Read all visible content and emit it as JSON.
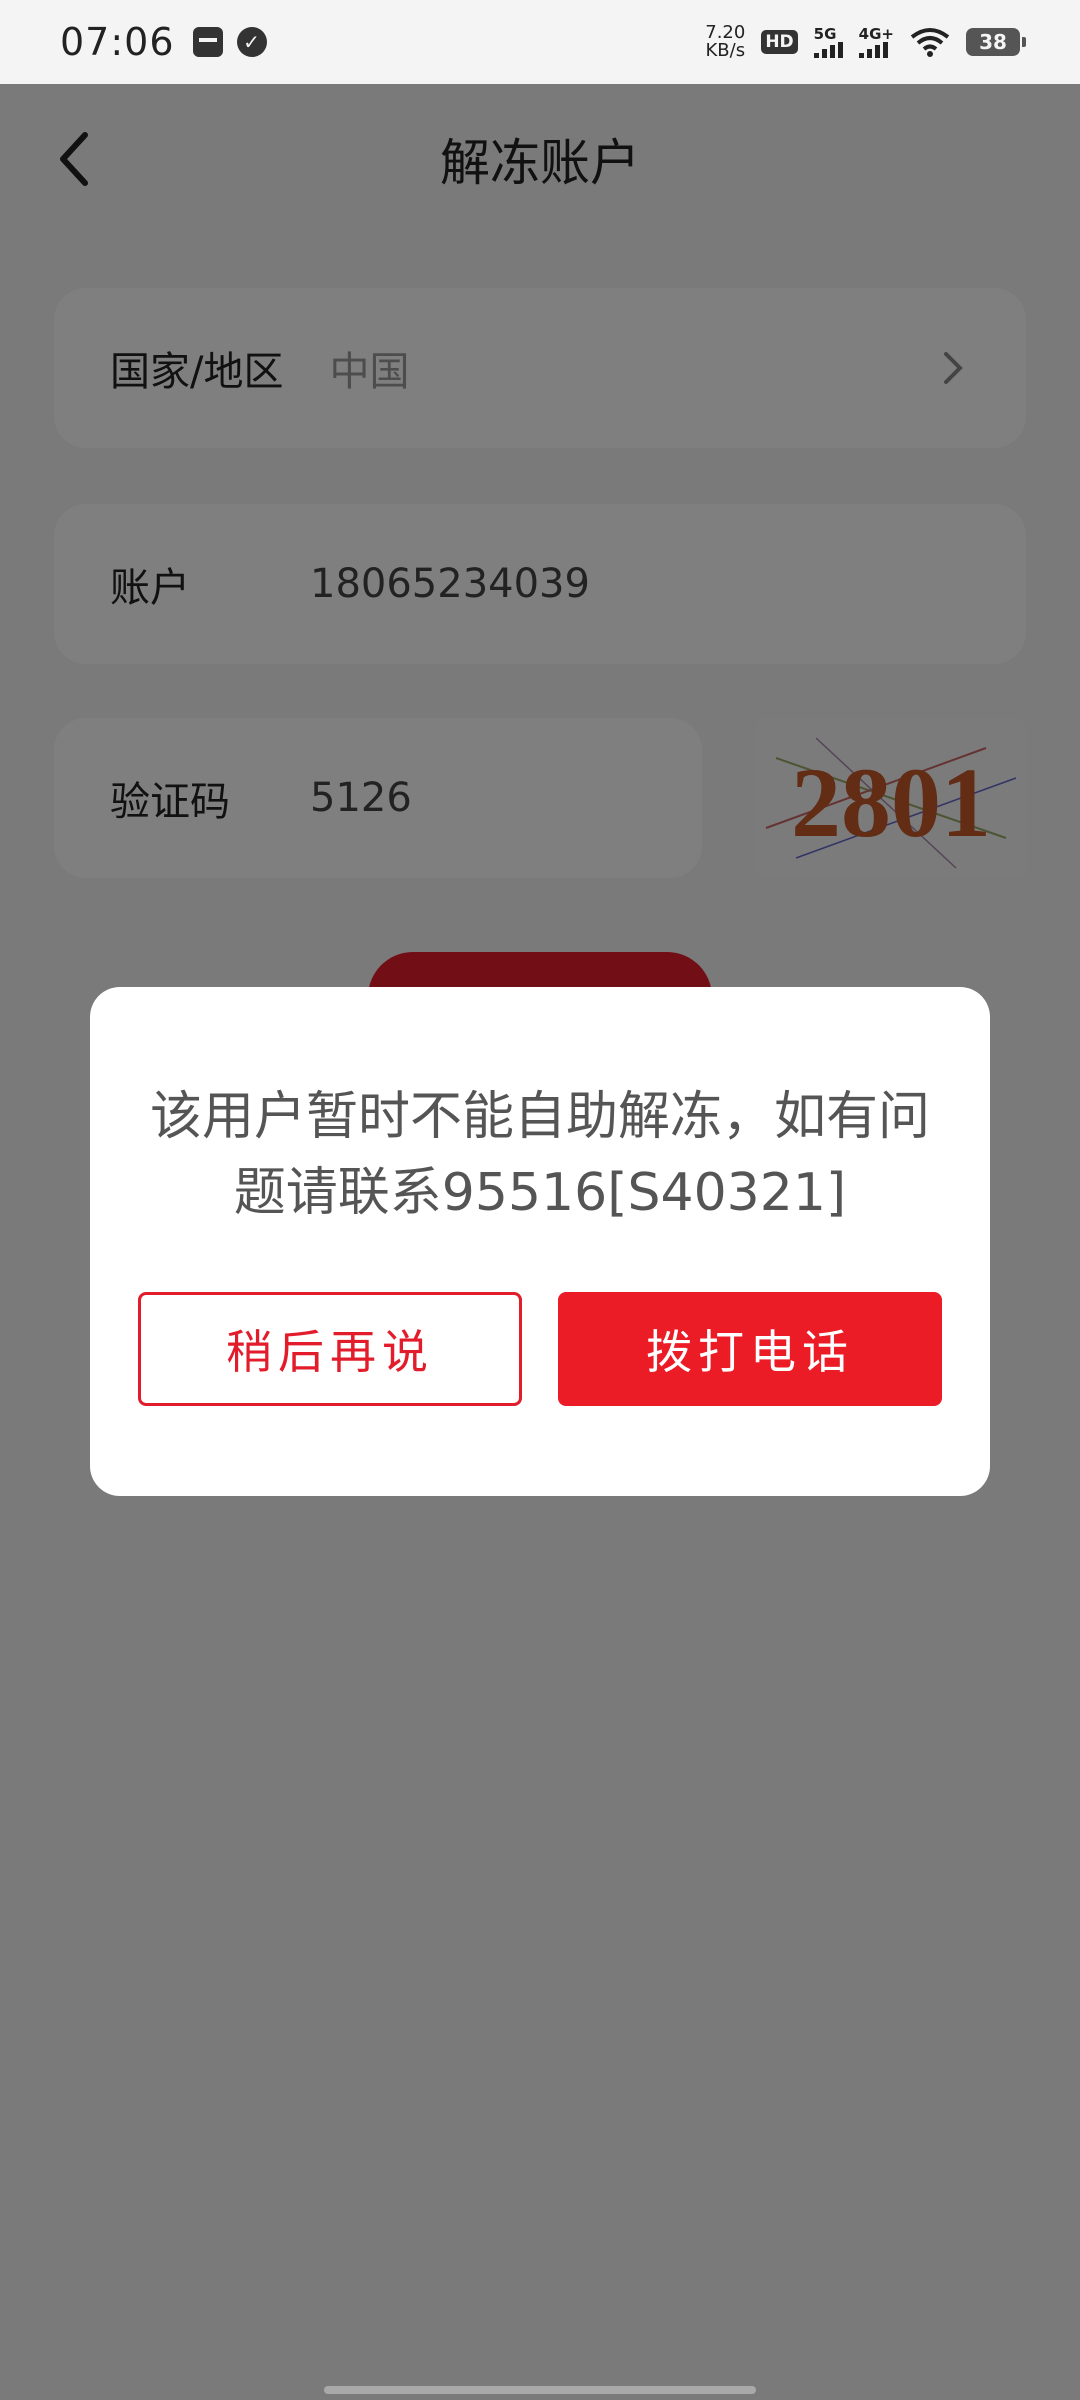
{
  "status_bar": {
    "time": "07:06",
    "speed_value": "7.20",
    "speed_unit": "KB/s",
    "hd_label": "HD",
    "sim1_label": "5G",
    "sim2_label": "4G+",
    "battery": "38"
  },
  "header": {
    "title": "解冻账户"
  },
  "form": {
    "region": {
      "label": "国家/地区",
      "value": "中国"
    },
    "account": {
      "label": "账户",
      "value": "18065234039"
    },
    "captcha": {
      "label": "验证码",
      "value": "5126",
      "image_text": "2801"
    }
  },
  "dialog": {
    "message": "该用户暂时不能自助解冻，如有问题请联系95516[S40321]",
    "later_label": "稍后再说",
    "call_label": "拨打电话"
  },
  "colors": {
    "accent": "#ec1c26",
    "overlay": "rgba(0,0,0,0.5)"
  }
}
